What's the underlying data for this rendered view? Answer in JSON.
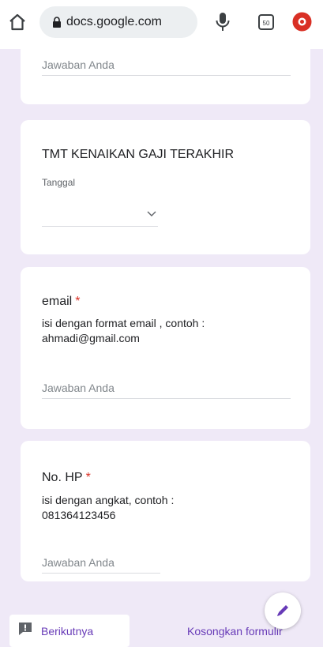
{
  "browser": {
    "url": "docs.google.com",
    "icons": {
      "home": "home-icon",
      "lock": "lock-icon",
      "mic": "mic-icon",
      "tabs": "tabs-icon",
      "download": "download-icon"
    },
    "accent_color": "#d93025"
  },
  "form": {
    "accent_color": "#673ab7",
    "background_color": "#efe9f7",
    "required_color": "#d93025",
    "top_card": {
      "answer_placeholder": "Jawaban Anda"
    },
    "tmt_question": {
      "title": "TMT KENAIKAN GAJI TERAKHIR",
      "date_label": "Tanggal"
    },
    "email_question": {
      "title": "email",
      "required_mark": "*",
      "description_lines": [
        "isi dengan format email , contoh :",
        "ahmadi@gmail.com"
      ],
      "answer_placeholder": "Jawaban Anda"
    },
    "phone_question": {
      "title": "No. HP",
      "required_mark": "*",
      "description_lines": [
        "isi dengan angkat, contoh :",
        "081364123456"
      ],
      "answer_placeholder": "Jawaban Anda"
    }
  },
  "footer": {
    "next_label": "Berikutnya",
    "clear_form_label": "Kosongkan formulir",
    "next_icon": "next-icon",
    "edit_icon": "pencil-icon"
  }
}
